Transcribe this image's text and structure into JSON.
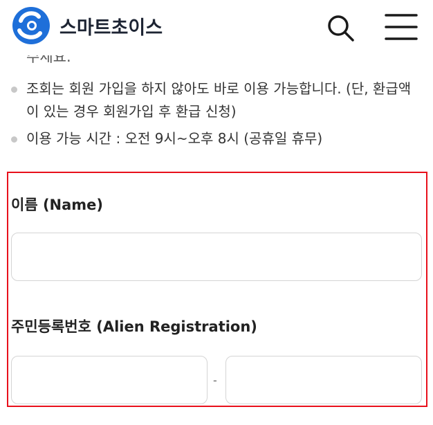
{
  "header": {
    "logo_text": "스마트초이스",
    "search_icon": "search-icon",
    "menu_icon": "hamburger-menu-icon",
    "brand_colors": {
      "blue": "#1e6fd9",
      "dark": "#1d2433"
    }
  },
  "partial_text": "주세요.",
  "notes": [
    "조회는 회원 가입을 하지 않아도 바로 이용 가능합니다. (단, 환급액이 있는 경우 회원가입 후 환급 신청)",
    "이용 가능 시간 : 오전 9시~오후 8시 (공휴일 휴무)"
  ],
  "form": {
    "highlight_color": "#e8101b",
    "name_label": "이름 (Name)",
    "name_value": "",
    "alien_label": "주민등록번호 (Alien Registration)",
    "reg_front_value": "",
    "reg_separator": "-",
    "reg_back_value": ""
  }
}
